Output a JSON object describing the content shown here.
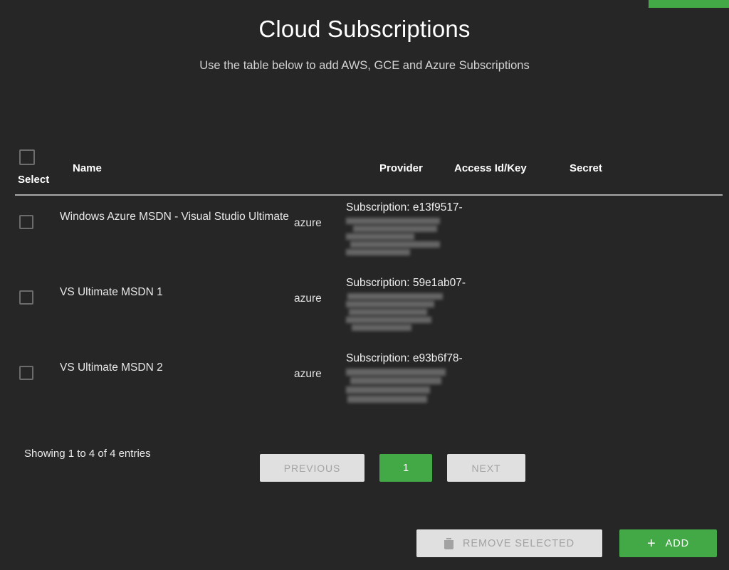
{
  "header": {
    "title": "Cloud Subscriptions",
    "subtitle": "Use the table below to add AWS, GCE and Azure Subscriptions",
    "accent_color": "#43a846"
  },
  "table": {
    "columns": {
      "select": "Select",
      "name": "Name",
      "provider": "Provider",
      "access": "Access Id/Key",
      "secret": "Secret"
    },
    "rows": [
      {
        "selected": false,
        "name": "Windows Azure MSDN - Visual Studio Ultimate",
        "provider": "azure",
        "access": "Subscription: e13f9517-",
        "access_redacted": true,
        "secret": ""
      },
      {
        "selected": false,
        "name": "VS Ultimate MSDN 1",
        "provider": "azure",
        "access": "Subscription: 59e1ab07-",
        "access_redacted": true,
        "secret": ""
      },
      {
        "selected": false,
        "name": "VS Ultimate MSDN 2",
        "provider": "azure",
        "access": "Subscription: e93b6f78-",
        "access_redacted": true,
        "secret": ""
      }
    ]
  },
  "footer": {
    "showing": "Showing 1 to 4 of 4 entries",
    "pagination": {
      "previous": "PREVIOUS",
      "current_page": "1",
      "next": "NEXT"
    }
  },
  "actions": {
    "remove_label": "REMOVE SELECTED",
    "remove_icon": "trash-icon",
    "add_label": "ADD",
    "add_icon": "plus-icon",
    "add_color": "#43a846"
  }
}
